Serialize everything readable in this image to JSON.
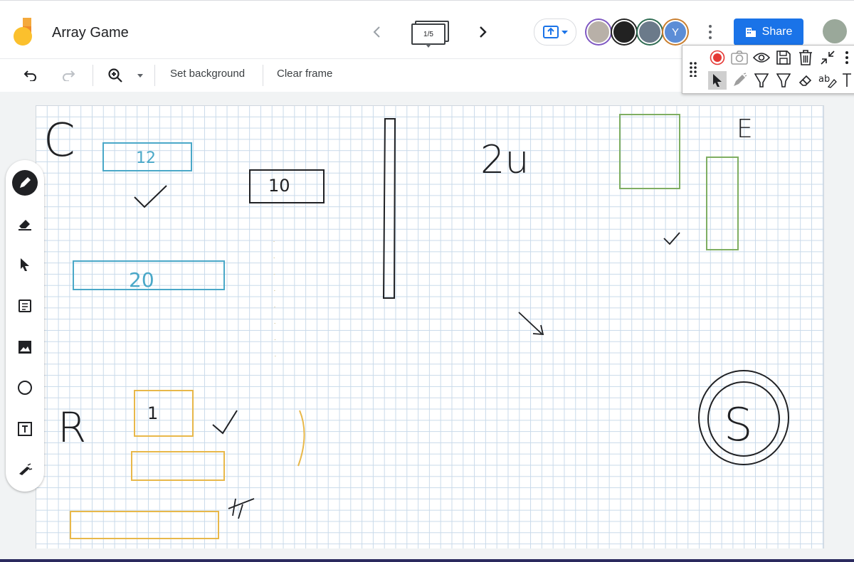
{
  "app": {
    "title": "Array Game"
  },
  "frames": {
    "counter": "1/5"
  },
  "header": {
    "share_label": "Share",
    "avatar_initial": "Y"
  },
  "toolbar": {
    "set_background": "Set background",
    "clear_frame": "Clear frame"
  },
  "canvas_text": {
    "c_letter": "C",
    "box1": "12",
    "box2": "10",
    "box3": "20",
    "two_u": "2u",
    "e_letter": "E",
    "r_letter": "R",
    "one": "1",
    "s_letter": "S"
  },
  "colors": {
    "accent": "#1a73e8",
    "ink_blue": "#4aa8c8",
    "ink_black": "#202124",
    "ink_green": "#7fae62",
    "ink_orange": "#e8b84a",
    "record": "#e53935"
  },
  "icons": {
    "left_tools": [
      "pen-icon",
      "eraser-icon",
      "select-arrow-icon",
      "sticky-note-icon",
      "image-icon",
      "circle-shape-icon",
      "text-box-icon",
      "laser-icon"
    ],
    "extension": [
      "record-icon",
      "camera-icon",
      "eye-icon",
      "save-icon",
      "trash-icon",
      "collapse-icon",
      "more-vert-icon",
      "pointer-icon",
      "pen-tool-icon",
      "highlighter-icon",
      "highlighter-alt-icon",
      "eraser-icon",
      "text-tool-icon",
      "text-cursor-icon"
    ]
  }
}
